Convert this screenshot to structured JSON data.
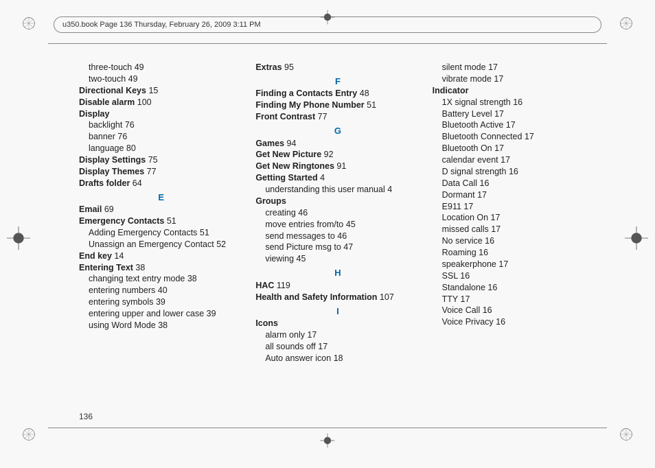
{
  "header": "u350.book  Page 136  Thursday, February 26, 2009  3:11 PM",
  "page_number": "136",
  "columns": [
    {
      "items": [
        {
          "text": "three-touch",
          "page": "49",
          "sub": true
        },
        {
          "text": "two-touch",
          "page": "49",
          "sub": true
        },
        {
          "text": "Directional Keys",
          "page": "15",
          "bold": true
        },
        {
          "text": "Disable alarm",
          "page": "100",
          "bold": true
        },
        {
          "text": "Display",
          "bold": true
        },
        {
          "text": "backlight",
          "page": "76",
          "sub": true
        },
        {
          "text": "banner",
          "page": "76",
          "sub": true
        },
        {
          "text": "language",
          "page": "80",
          "sub": true
        },
        {
          "text": "Display Settings",
          "page": "75",
          "bold": true
        },
        {
          "text": "Display Themes",
          "page": "77",
          "bold": true
        },
        {
          "text": "Drafts folder",
          "page": "64",
          "bold": true
        },
        {
          "letter": "E"
        },
        {
          "text": "Email",
          "page": "69",
          "bold": true
        },
        {
          "text": "Emergency Contacts",
          "page": "51",
          "bold": true
        },
        {
          "text": "Adding Emergency Contacts",
          "page": "51",
          "sub": true
        },
        {
          "text": "Unassign an Emergency Contact",
          "page": "52",
          "sub": true
        },
        {
          "text": "End key",
          "page": "14",
          "bold": true
        },
        {
          "text": "Entering Text",
          "page": "38",
          "bold": true
        },
        {
          "text": "changing text entry mode",
          "page": "38",
          "sub": true
        },
        {
          "text": "entering numbers",
          "page": "40",
          "sub": true
        },
        {
          "text": "entering symbols",
          "page": "39",
          "sub": true
        },
        {
          "text": "entering upper and lower case",
          "page": "39",
          "sub": true
        },
        {
          "text": "using Word Mode",
          "page": "38",
          "sub": true
        }
      ]
    },
    {
      "items": [
        {
          "text": "Extras",
          "page": "95",
          "bold": true
        },
        {
          "letter": "F"
        },
        {
          "text": "Finding a Contacts Entry",
          "page": "48",
          "bold": true
        },
        {
          "text": "Finding My Phone Number",
          "page": "51",
          "bold": true
        },
        {
          "text": "Front Contrast",
          "page": "77",
          "bold": true
        },
        {
          "letter": "G"
        },
        {
          "text": "Games",
          "page": "94",
          "bold": true
        },
        {
          "text": "Get New Picture",
          "page": "92",
          "bold": true
        },
        {
          "text": "Get New Ringtones",
          "page": "91",
          "bold": true
        },
        {
          "text": "Getting Started",
          "page": "4",
          "bold": true
        },
        {
          "text": "understanding this user manual",
          "page": "4",
          "sub": true
        },
        {
          "text": "Groups",
          "bold": true
        },
        {
          "text": "creating",
          "page": "46",
          "sub": true
        },
        {
          "text": "move entries from/to",
          "page": "45",
          "sub": true
        },
        {
          "text": "send messages to",
          "page": "46",
          "sub": true
        },
        {
          "text": "send Picture msg to",
          "page": "47",
          "sub": true
        },
        {
          "text": "viewing",
          "page": "45",
          "sub": true
        },
        {
          "letter": "H"
        },
        {
          "text": "HAC",
          "page": "119",
          "bold": true
        },
        {
          "text": "Health and Safety Information",
          "page": "107",
          "bold": true
        },
        {
          "letter": "I"
        },
        {
          "text": "Icons",
          "bold": true
        },
        {
          "text": "alarm only",
          "page": "17",
          "sub": true
        },
        {
          "text": "all sounds off",
          "page": "17",
          "sub": true
        },
        {
          "text": "Auto answer icon",
          "page": "18",
          "sub": true
        }
      ]
    },
    {
      "items": [
        {
          "text": "silent mode",
          "page": "17",
          "sub": true
        },
        {
          "text": "vibrate mode",
          "page": "17",
          "sub": true
        },
        {
          "text": "Indicator",
          "bold": true
        },
        {
          "text": "1X signal strength",
          "page": "16",
          "sub": true
        },
        {
          "text": "Battery Level",
          "page": "17",
          "sub": true
        },
        {
          "text": "Bluetooth Active",
          "page": "17",
          "sub": true
        },
        {
          "text": "Bluetooth Connected",
          "page": "17",
          "sub": true
        },
        {
          "text": "Bluetooth On",
          "page": "17",
          "sub": true
        },
        {
          "text": "calendar event",
          "page": "17",
          "sub": true
        },
        {
          "text": "D signal strength",
          "page": "16",
          "sub": true
        },
        {
          "text": "Data Call",
          "page": "16",
          "sub": true
        },
        {
          "text": "Dormant",
          "page": "17",
          "sub": true
        },
        {
          "text": "E911",
          "page": "17",
          "sub": true
        },
        {
          "text": "Location On",
          "page": "17",
          "sub": true
        },
        {
          "text": "missed calls",
          "page": "17",
          "sub": true
        },
        {
          "text": "No service",
          "page": "16",
          "sub": true
        },
        {
          "text": "Roaming",
          "page": "16",
          "sub": true
        },
        {
          "text": "speakerphone",
          "page": "17",
          "sub": true
        },
        {
          "text": "SSL",
          "page": "16",
          "sub": true
        },
        {
          "text": "Standalone",
          "page": "16",
          "sub": true
        },
        {
          "text": "TTY",
          "page": "17",
          "sub": true
        },
        {
          "text": "Voice Call",
          "page": "16",
          "sub": true
        },
        {
          "text": "Voice Privacy",
          "page": "16",
          "sub": true
        }
      ]
    }
  ]
}
